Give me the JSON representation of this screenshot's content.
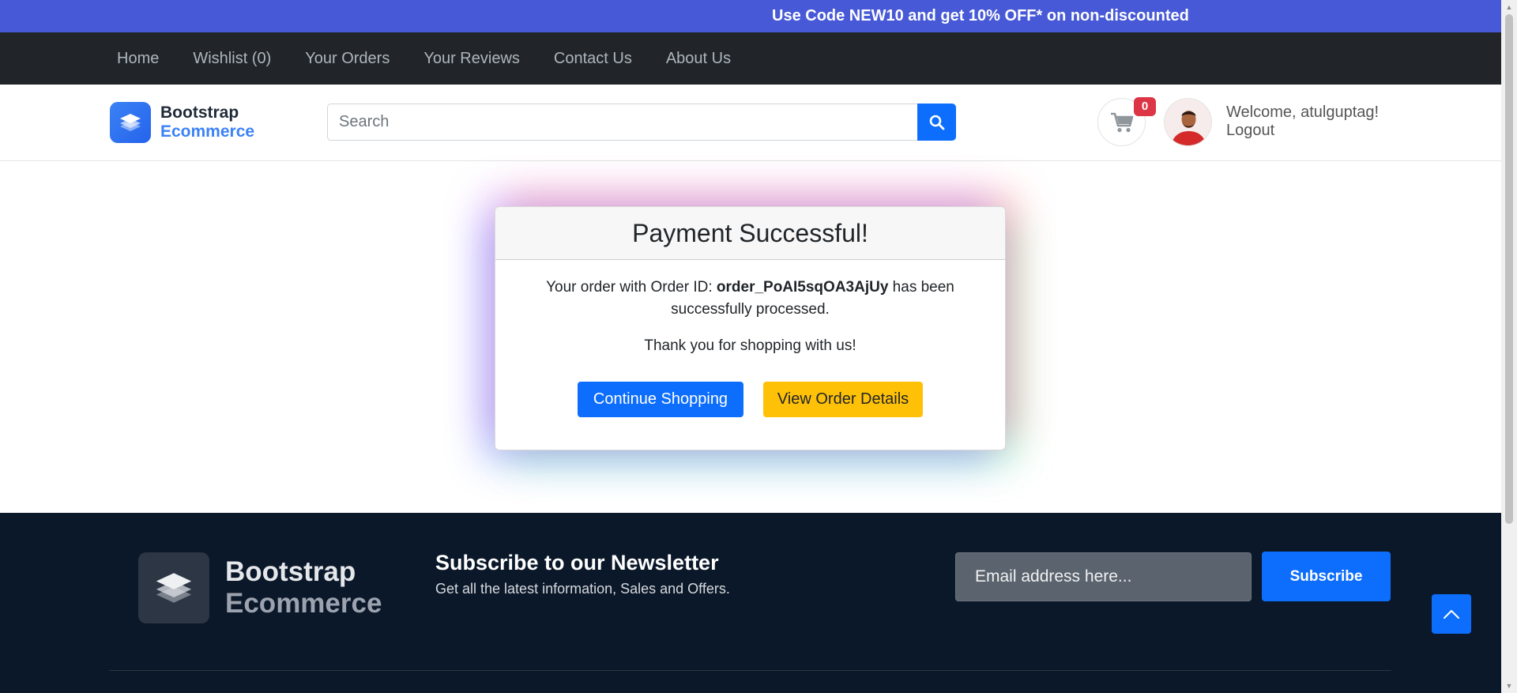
{
  "promo": {
    "text": "Use Code NEW10 and get 10% OFF* on non-discounted"
  },
  "nav": {
    "items": [
      "Home",
      "Wishlist (0)",
      "Your Orders",
      "Your Reviews",
      "Contact Us",
      "About Us"
    ]
  },
  "header": {
    "brand_line1": "Bootstrap",
    "brand_line2": "Ecommerce",
    "search_placeholder": "Search",
    "cart_count": "0",
    "welcome": "Welcome, atulguptag!",
    "logout": "Logout"
  },
  "payment": {
    "title": "Payment Successful!",
    "msg_before": "Your order with Order ID: ",
    "order_id": "order_PoAI5sqOA3AjUy",
    "msg_after": " has been successfully processed.",
    "thanks": "Thank you for shopping with us!",
    "continue_label": "Continue Shopping",
    "view_label": "View Order Details"
  },
  "footer": {
    "brand_line1": "Bootstrap",
    "brand_line2": "Ecommerce",
    "newsletter_title": "Subscribe to our Newsletter",
    "newsletter_sub": "Get all the latest information, Sales and Offers.",
    "email_placeholder": "Email address here...",
    "subscribe_label": "Subscribe"
  },
  "colors": {
    "promo_bg": "#4759d6",
    "nav_bg": "#212529",
    "primary": "#0d6efd",
    "warning": "#ffc107",
    "footer_bg": "#0b1829",
    "badge": "#dc3545"
  },
  "icons": {
    "logo": "layers-icon",
    "search": "search-icon",
    "cart": "cart-icon",
    "to_top": "chevron-up-icon"
  }
}
